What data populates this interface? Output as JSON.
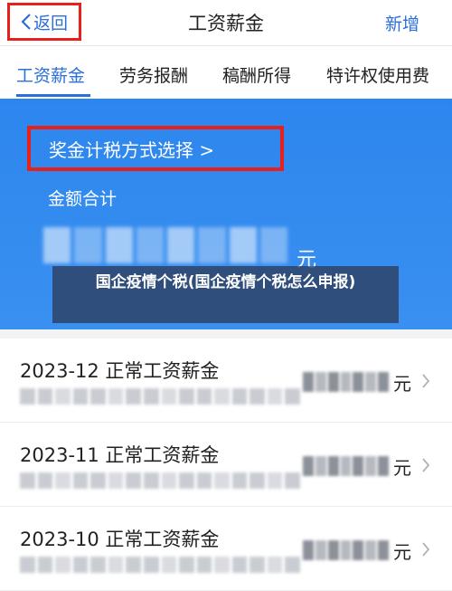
{
  "navbar": {
    "back_label": "返回",
    "title": "工资薪金",
    "action_label": "新增"
  },
  "tabs": [
    {
      "label": "工资薪金",
      "active": true
    },
    {
      "label": "劳务报酬",
      "active": false
    },
    {
      "label": "稿酬所得",
      "active": false
    },
    {
      "label": "特许权使用费",
      "active": false
    }
  ],
  "panel": {
    "method_label": "奖金计税方式选择 >",
    "amount_label": "金额合计",
    "amount_unit": "元"
  },
  "caption": "国企疫情个税(国企疫情个税怎么申报)",
  "records": [
    {
      "title": "2023-12 正常工资薪金",
      "unit": "元"
    },
    {
      "title": "2023-11 正常工资薪金",
      "unit": "元"
    },
    {
      "title": "2023-10 正常工资薪金",
      "unit": "元"
    }
  ],
  "colors": {
    "accent": "#2b6fd8",
    "panel": "#2d86ee",
    "highlight": "#e8201b"
  },
  "icons": {
    "back": "chevron-left-icon",
    "record": "chevron-right-icon"
  }
}
